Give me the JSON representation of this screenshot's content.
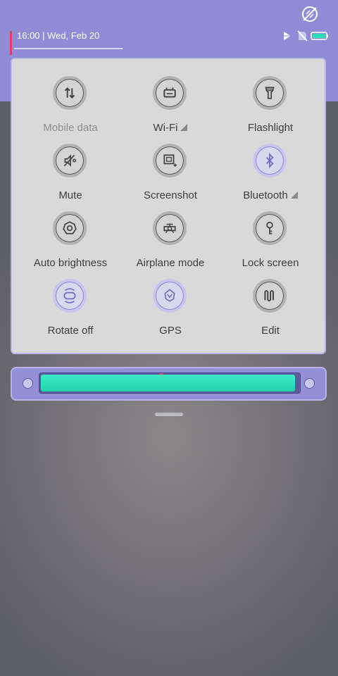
{
  "status_bar": {
    "datetime": "16:00 | Wed, Feb 20",
    "icons": [
      "no-sim-icon",
      "play-store-icon",
      "battery-icon"
    ],
    "top_icon": "no-vibrate-icon"
  },
  "tiles": [
    {
      "label": "Mobile data",
      "icon": "mobile-data-icon",
      "active": false,
      "dimmed": true,
      "expandable": false
    },
    {
      "label": "Wi-Fi",
      "icon": "wifi-icon",
      "active": false,
      "dimmed": false,
      "expandable": true
    },
    {
      "label": "Flashlight",
      "icon": "flashlight-icon",
      "active": false,
      "dimmed": false,
      "expandable": false
    },
    {
      "label": "Mute",
      "icon": "mute-icon",
      "active": false,
      "dimmed": false,
      "expandable": false
    },
    {
      "label": "Screenshot",
      "icon": "screenshot-icon",
      "active": false,
      "dimmed": false,
      "expandable": false
    },
    {
      "label": "Bluetooth",
      "icon": "bluetooth-icon",
      "active": true,
      "dimmed": false,
      "expandable": true
    },
    {
      "label": "Auto brightness",
      "icon": "auto-brightness-icon",
      "active": false,
      "dimmed": false,
      "expandable": false
    },
    {
      "label": "Airplane mode",
      "icon": "airplane-icon",
      "active": false,
      "dimmed": false,
      "expandable": false
    },
    {
      "label": "Lock screen",
      "icon": "lock-key-icon",
      "active": false,
      "dimmed": false,
      "expandable": false
    },
    {
      "label": "Rotate off",
      "icon": "rotate-icon",
      "active": true,
      "dimmed": false,
      "expandable": false
    },
    {
      "label": "GPS",
      "icon": "gps-icon",
      "active": true,
      "dimmed": false,
      "expandable": false
    },
    {
      "label": "Edit",
      "icon": "edit-icon",
      "active": false,
      "dimmed": false,
      "expandable": false
    }
  ],
  "brightness": {
    "level": 0.99
  },
  "colors": {
    "header": "#8f8bd4",
    "panel": "#d9d9d9",
    "accent": "#8a86cf",
    "slider_fill": "#2ddcb8",
    "battery": "#2ddcb8"
  }
}
